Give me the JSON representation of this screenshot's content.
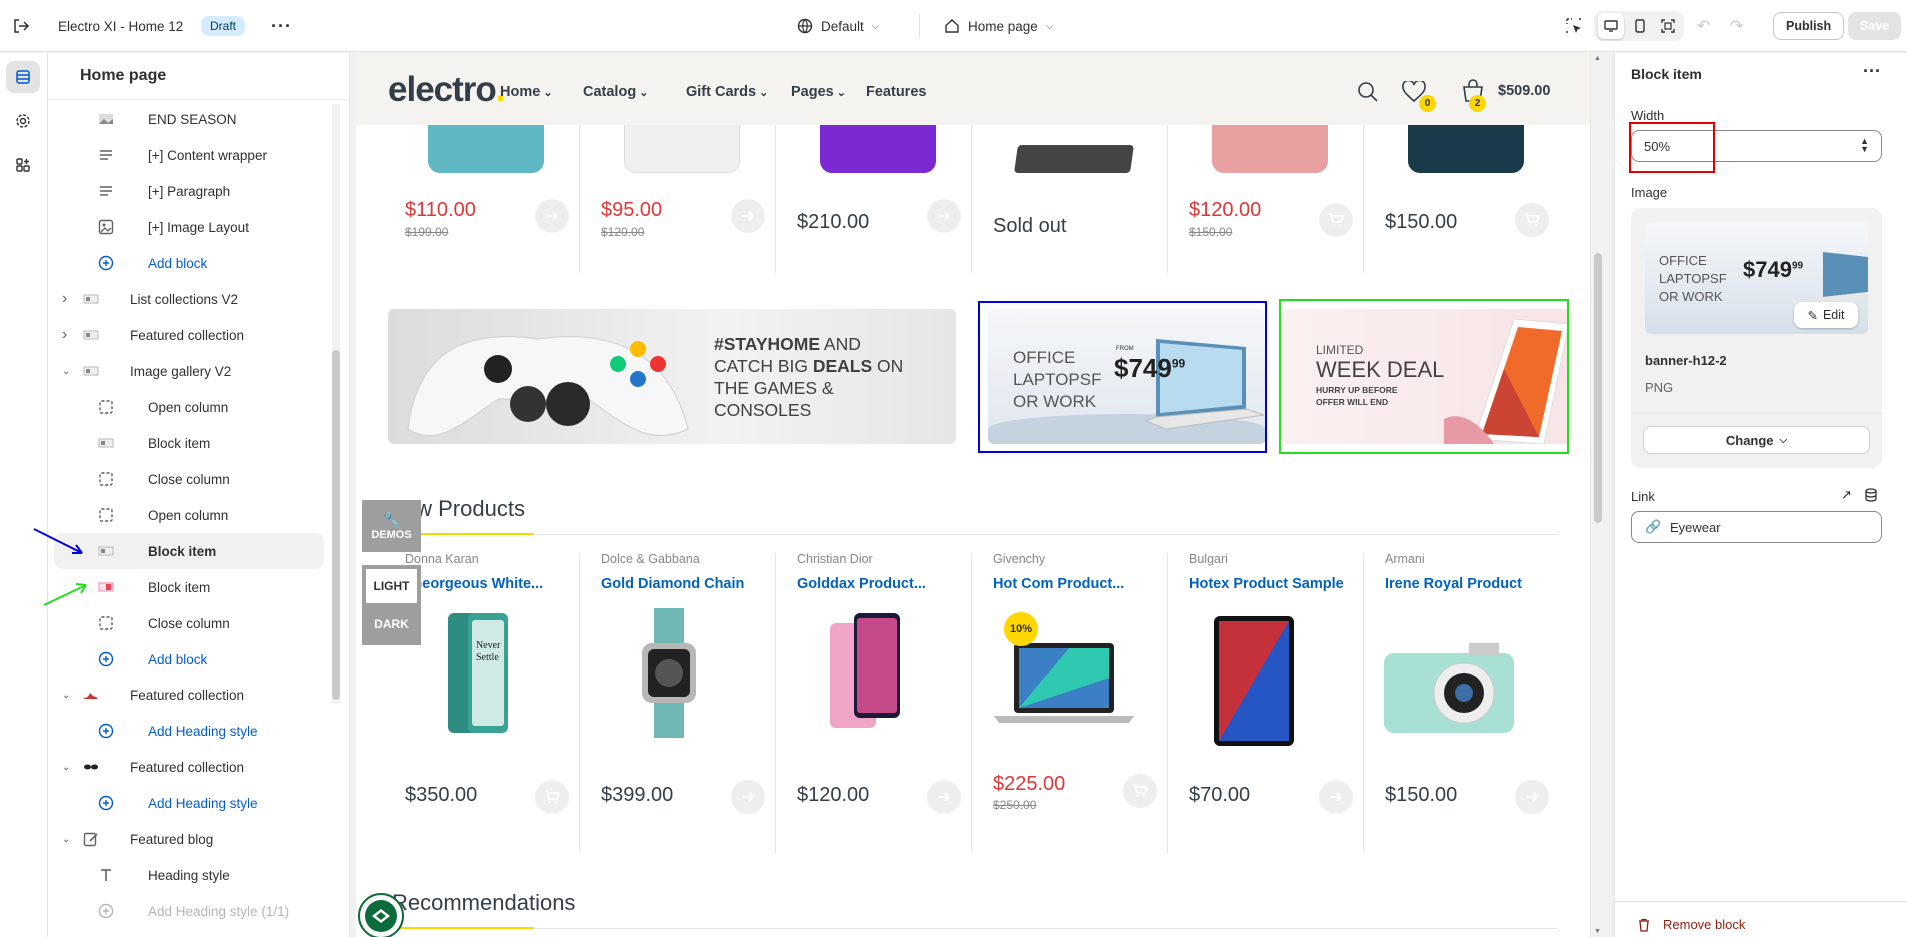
{
  "topbar": {
    "theme_name": "Electro XI - Home 12",
    "status_badge": "Draft",
    "theme_selector": "Default",
    "page_selector": "Home page",
    "publish_label": "Publish",
    "save_label": "Save"
  },
  "left_panel": {
    "title": "Home page",
    "items": [
      {
        "label": "END SEASON"
      },
      {
        "label": "[+] Content wrapper"
      },
      {
        "label": "[+] Paragraph"
      },
      {
        "label": "[+] Image Layout"
      },
      {
        "label": "Add block"
      },
      {
        "label": "List collections V2"
      },
      {
        "label": "Featured collection"
      },
      {
        "label": "Image gallery V2"
      },
      {
        "label": "Open column"
      },
      {
        "label": "Block item"
      },
      {
        "label": "Close column"
      },
      {
        "label": "Open column"
      },
      {
        "label": "Block item"
      },
      {
        "label": "Block item"
      },
      {
        "label": "Close column"
      },
      {
        "label": "Add block"
      },
      {
        "label": "Featured collection"
      },
      {
        "label": "Add Heading style"
      },
      {
        "label": "Featured collection"
      },
      {
        "label": "Add Heading style"
      },
      {
        "label": "Featured blog"
      },
      {
        "label": "Heading style"
      },
      {
        "label": "Add Heading style (1/1)"
      }
    ]
  },
  "site": {
    "logo_text": "electro",
    "logo_dot": ".",
    "nav": [
      "Home",
      "Catalog",
      "Gift Cards",
      "Pages",
      "Features"
    ],
    "wishlist_count": "0",
    "cart_count": "2",
    "cart_total": "$509.00",
    "top_products": [
      {
        "price": "$110.00",
        "old_price": "$199.00",
        "sale": true
      },
      {
        "price": "$95.00",
        "old_price": "$120.00",
        "sale": true
      },
      {
        "price": "$210.00",
        "old_price": "",
        "sale": false
      },
      {
        "price": "Sold out",
        "old_price": "",
        "sale": false
      },
      {
        "price": "$120.00",
        "old_price": "$150.00",
        "sale": true
      },
      {
        "price": "$150.00",
        "old_price": "",
        "sale": false
      }
    ],
    "banner_console": {
      "line1": "#STAYHOME AND",
      "line2": "CATCH BIG DEALS ON",
      "line3": "THE GAMES &",
      "line4": "CONSOLES",
      "bold1": "#STAYHOME",
      "bold2": "DEALS"
    },
    "banner_laptop": {
      "line1": "OFFICE",
      "line2": "LAPTOPSF",
      "line3": "OR WORK",
      "from": "FROM",
      "price": "$749",
      "cents": "99"
    },
    "banner_weekdeal": {
      "line1": "LIMITED",
      "line2": "WEEK DEAL",
      "line3": "HURRY UP BEFORE",
      "line4": "OFFER WILL END"
    },
    "demos_label": "DEMOS",
    "light_label": "LIGHT",
    "dark_label": "DARK",
    "new_products_title": "New Products",
    "new_products": [
      {
        "brand": "Donna Karan",
        "name": "Georgeous White...",
        "price": "$350.00",
        "old_price": "",
        "sale": false
      },
      {
        "brand": "Dolce & Gabbana",
        "name": "Gold Diamond Chain",
        "price": "$399.00",
        "old_price": "",
        "sale": false
      },
      {
        "brand": "Christian Dior",
        "name": "Golddax Product...",
        "price": "$120.00",
        "old_price": "",
        "sale": false
      },
      {
        "brand": "Givenchy",
        "name": "Hot Com Product...",
        "price": "$225.00",
        "old_price": "$250.00",
        "sale": true,
        "discount": "10%"
      },
      {
        "brand": "Bulgari",
        "name": "Hotex Product Sample",
        "price": "$70.00",
        "old_price": "",
        "sale": false
      },
      {
        "brand": "Armani",
        "name": "Irene Royal Product",
        "price": "$150.00",
        "old_price": "",
        "sale": false
      }
    ],
    "phone_screen_text": "Never Settle",
    "recommendations_title": "Recommendations"
  },
  "right_panel": {
    "title": "Block item",
    "width_label": "Width",
    "width_value": "50%",
    "image_label": "Image",
    "edit_label": "Edit",
    "image_name": "banner-h12-2",
    "image_type": "PNG",
    "change_label": "Change",
    "link_label": "Link",
    "link_value": "Eyewear",
    "remove_label": "Remove block"
  },
  "colors": {
    "brand_yellow": "#fed700",
    "sale_red": "#df3737",
    "link_blue": "#0062bd",
    "admin_blue": "#005bd3",
    "highlight_red": "#e00000",
    "highlight_blue": "#0000e0",
    "highlight_green": "#22dd22"
  }
}
